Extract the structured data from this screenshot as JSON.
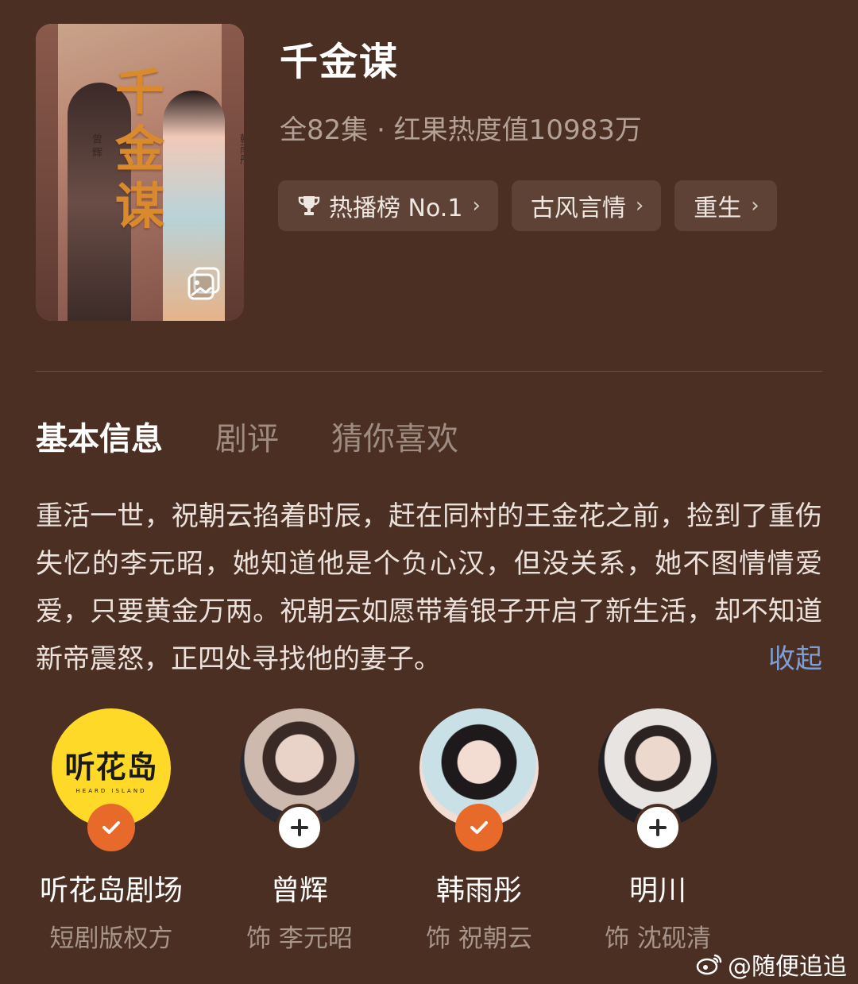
{
  "poster": {
    "title_art": "千金谋",
    "credit_left": "曾 辉",
    "credit_right": "韩雨彤"
  },
  "show": {
    "title": "千金谋",
    "meta": "全82集 · 红果热度值10983万"
  },
  "tags": [
    {
      "label": "热播榜 No.1",
      "icon": "trophy-icon"
    },
    {
      "label": "古风言情"
    },
    {
      "label": "重生"
    }
  ],
  "tabs": [
    {
      "label": "基本信息",
      "active": true
    },
    {
      "label": "剧评"
    },
    {
      "label": "猜你喜欢"
    }
  ],
  "synopsis": {
    "text": "重活一世，祝朝云掐着时辰，赶在同村的王金花之前，捡到了重伤失忆的李元昭，她知道他是个负心汉，但没关系，她不图情情爱爱，只要黄金万两。祝朝云如愿带着银子开启了新生活，却不知道新帝震怒，正四处寻找他的妻子。",
    "collapse_label": "收起"
  },
  "people": [
    {
      "name": "听花岛剧场",
      "role": "短剧版权方",
      "status": "followed",
      "logo_text": "听花岛",
      "logo_sub": "HEARD ISLAND"
    },
    {
      "name": "曾辉",
      "role": "饰 李元昭",
      "status": "add"
    },
    {
      "name": "韩雨彤",
      "role": "饰 祝朝云",
      "status": "followed"
    },
    {
      "name": "明川",
      "role": "饰 沈砚清",
      "status": "add"
    }
  ],
  "watermark": "@随便追追",
  "colors": {
    "background": "#4a2f22",
    "follow_badge": "#e86a2b",
    "collapse_link": "#7d9fd6",
    "logo_yellow": "#ffd928"
  }
}
